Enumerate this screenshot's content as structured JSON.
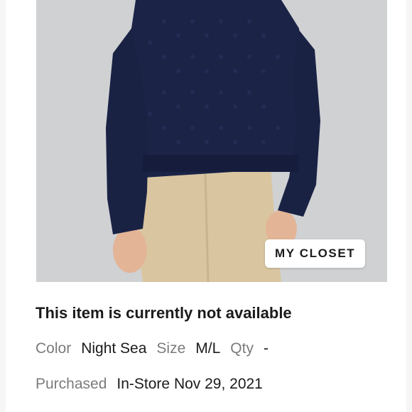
{
  "product_image": {
    "icon": "sweater-photo",
    "colors": {
      "sweater": "#1b2447",
      "pants": "#d9c6a1",
      "background": "#cfd1d3"
    }
  },
  "badge": {
    "label": "MY CLOSET"
  },
  "status_text": "This item is currently not available",
  "details": {
    "color_label": "Color",
    "color_value": "Night Sea",
    "size_label": "Size",
    "size_value": "M/L",
    "qty_label": "Qty",
    "qty_value": "-",
    "purchased_label": "Purchased",
    "purchased_value": "In-Store Nov 29, 2021"
  }
}
